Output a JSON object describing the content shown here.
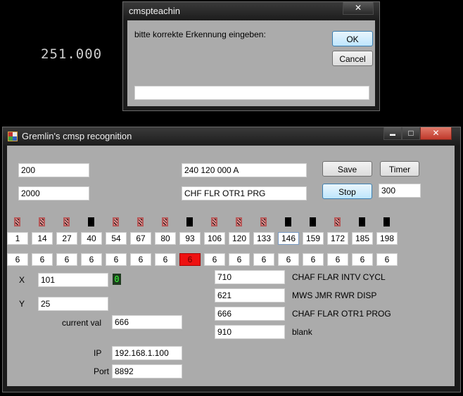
{
  "lcd_value": "251.000",
  "dialog": {
    "title": "cmspteachin",
    "prompt": "bitte korrekte Erkennung eingeben:",
    "ok_label": "OK",
    "cancel_label": "Cancel",
    "input_value": "",
    "close_glyph": "✕"
  },
  "main": {
    "title": "Gremlin's cmsp recognition",
    "minimize_glyph": "▬",
    "maximize_glyph": "□",
    "close_glyph": "✕",
    "field1": "200",
    "field2": "2000",
    "field3": "240 120 000  A",
    "field4": "CHF FLR OTR1 PRG",
    "save_label": "Save",
    "timer_label": "Timer",
    "stop_label": "Stop",
    "timer_value": "300",
    "signals": [
      true,
      true,
      true,
      false,
      true,
      true,
      true,
      false,
      true,
      true,
      true,
      false,
      false,
      true,
      false,
      false
    ],
    "offsets": [
      "1",
      "14",
      "27",
      "40",
      "54",
      "67",
      "80",
      "93",
      "106",
      "120",
      "133",
      "146",
      "159",
      "172",
      "185",
      "198"
    ],
    "thresholds": [
      "6",
      "6",
      "6",
      "6",
      "6",
      "6",
      "6",
      "6",
      "6",
      "6",
      "6",
      "6",
      "6",
      "6",
      "6",
      "6"
    ],
    "highlight_index": 7,
    "x_label": "X",
    "x_value": "101",
    "y_label": "Y",
    "y_value": "25",
    "result_glyph": "0",
    "current_val_label": "current val",
    "current_val": "666",
    "ip_label": "IP",
    "ip_value": "192.168.1.100",
    "port_label": "Port",
    "port_value": "8892",
    "mappings": [
      {
        "code": "710",
        "text": "CHAF FLAR INTV CYCL"
      },
      {
        "code": "621",
        "text": "MWS JMR RWR DISP"
      },
      {
        "code": "666",
        "text": "CHAF FLAR  OTR1 PROG"
      },
      {
        "code": "910",
        "text": "blank"
      }
    ],
    "colors": {
      "highlight": "#ee1111",
      "client_bg": "#ababab",
      "result_glyph": "#3cff3c"
    }
  }
}
